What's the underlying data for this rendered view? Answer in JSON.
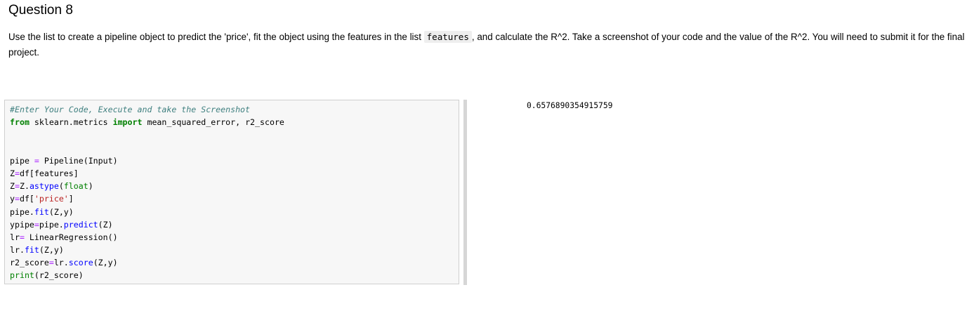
{
  "question": {
    "title": "Question 8",
    "text_before": "Use the list to create a pipeline object to predict the 'price', fit the object using the features in the list ",
    "inline_code": "features",
    "text_after": ", and calculate the R^2. Take a screenshot of your code and the value of the R^2. You will need to submit it for the final project."
  },
  "code_cell": {
    "comment": "#Enter Your Code, Execute and take the Screenshot",
    "lines": {
      "l1_from": "from",
      "l1_mod": " sklearn.metrics ",
      "l1_import": "import",
      "l1_rest": " mean_squared_error, r2_score",
      "l4_a": "pipe ",
      "l4_eq": "=",
      "l4_b": " Pipeline(Input)",
      "l5_a": "Z",
      "l5_eq": "=",
      "l5_b": "df[features]",
      "l6_a": "Z",
      "l6_eq": "=",
      "l6_b": "Z.",
      "l6_fn": "astype",
      "l6_c": "(",
      "l6_bi": "float",
      "l6_d": ")",
      "l7_a": "y",
      "l7_eq": "=",
      "l7_b": "df[",
      "l7_str": "'price'",
      "l7_c": "]",
      "l8_a": "pipe.",
      "l8_fn": "fit",
      "l8_b": "(Z,y)",
      "l9_a": "ypipe",
      "l9_eq": "=",
      "l9_b": "pipe.",
      "l9_fn": "predict",
      "l9_c": "(Z)",
      "l10_a": "lr",
      "l10_eq": "=",
      "l10_b": " LinearRegression()",
      "l11_a": "lr.",
      "l11_fn": "fit",
      "l11_b": "(Z,y)",
      "l12_a": "r2_score",
      "l12_eq": "=",
      "l12_b": "lr.",
      "l12_fn": "score",
      "l12_c": "(Z,y)",
      "l13_bi": "print",
      "l13_b": "(r2_score)"
    }
  },
  "output": {
    "value": "0.6576890354915759"
  },
  "colors": {
    "comment": "#408080",
    "keyword": "#008000",
    "operator": "#aa22ff",
    "string": "#ba2121",
    "function": "#0000ff",
    "cell_background": "#f7f7f7",
    "cell_border": "#cfcfcf"
  }
}
